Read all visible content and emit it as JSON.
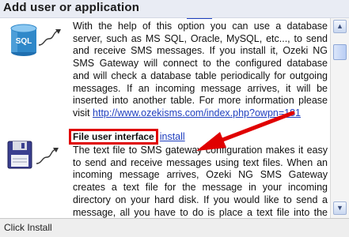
{
  "window": {
    "title": "Add user or application"
  },
  "sql_section": {
    "icon_label": "SQL",
    "description": "With the help of this option you can use a database server, such as MS SQL, Oracle, MySQL, etc..., to send and receive SMS messages. If you install it, Ozeki NG SMS Gateway will connect to the configured database and will check a database table periodically for outgoing messages. If an incoming message arrives, it will be inserted into another table. For more information please visit",
    "more_info_link": "http://www.ozekisms.com/index.php?owpn=181"
  },
  "file_section": {
    "heading": "File user interface",
    "install_label": "install",
    "description": "The text file to SMS gateway configuration makes it easy to send and receive messages using text files. When an incoming message arrives, Ozeki NG SMS Gateway creates a text file for the message in your incoming directory on your hard disk. If you would like to send a message, all you have to do is place a text file into the outgoing directory. For more information please visit"
  },
  "status_bar": {
    "text": "Click Install"
  },
  "colors": {
    "highlight": "#e00000",
    "link": "#1f3fbf",
    "title_bar": "#e9ecf4"
  }
}
